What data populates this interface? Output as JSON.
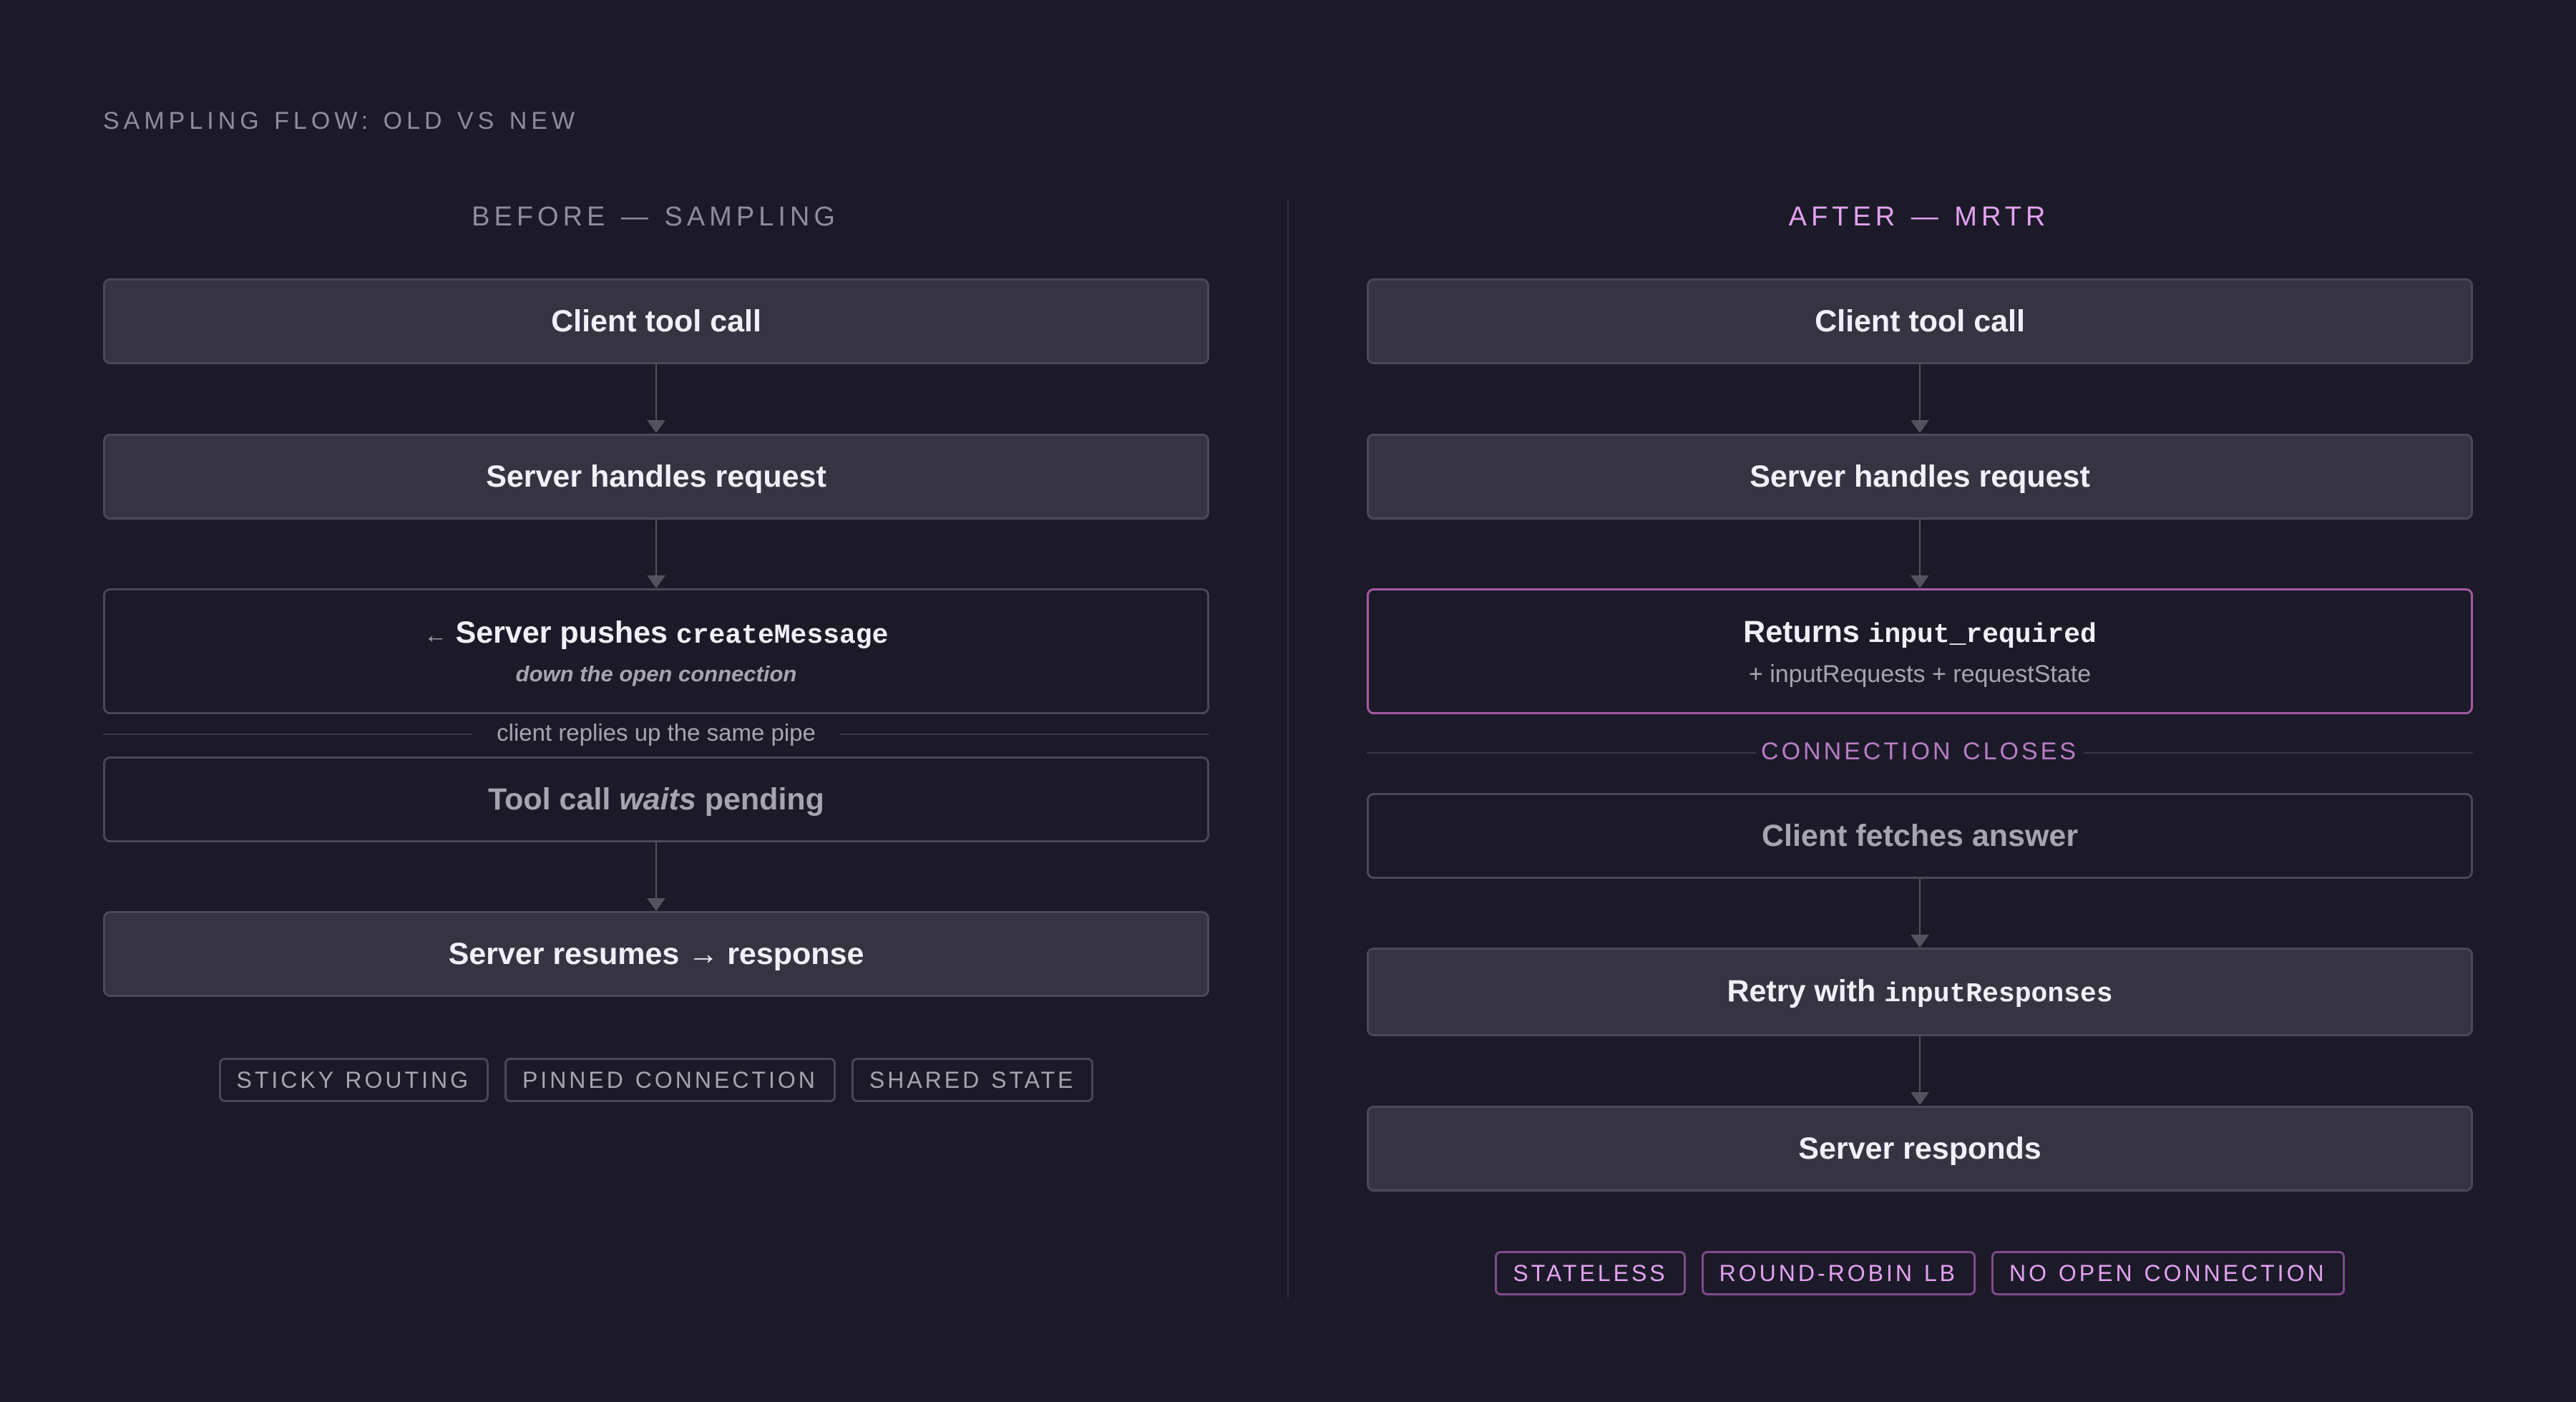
{
  "title": "SAMPLING FLOW: OLD VS NEW",
  "before": {
    "heading": "BEFORE — SAMPLING",
    "step1": "Client tool call",
    "step2": "Server handles request",
    "step3": {
      "arrow": "←",
      "text": "Server pushes",
      "code": "createMessage",
      "sub": "down the open connection"
    },
    "separator": "client replies up the same pipe",
    "step4": {
      "pre": "Tool call",
      "em": "waits",
      "post": "pending"
    },
    "step5": "Server resumes → response",
    "tags": [
      "STICKY ROUTING",
      "PINNED CONNECTION",
      "SHARED STATE"
    ]
  },
  "after": {
    "heading": "AFTER — MRTR",
    "step1": "Client tool call",
    "step2": "Server handles request",
    "step3": {
      "text": "Returns",
      "code": "input_required",
      "sub": "+ inputRequests + requestState"
    },
    "separator": "CONNECTION CLOSES",
    "step4": "Client fetches answer",
    "step5": {
      "text": "Retry with",
      "code": "inputResponses"
    },
    "step6": "Server responds",
    "tags": [
      "STATELESS",
      "ROUND-ROBIN LB",
      "NO OPEN CONNECTION"
    ]
  },
  "colors": {
    "background": "#1c1a29",
    "box_fill": "#363342",
    "box_border": "#4b4858",
    "accent": "#e3a2f0",
    "muted_text": "#8f8c9e"
  }
}
